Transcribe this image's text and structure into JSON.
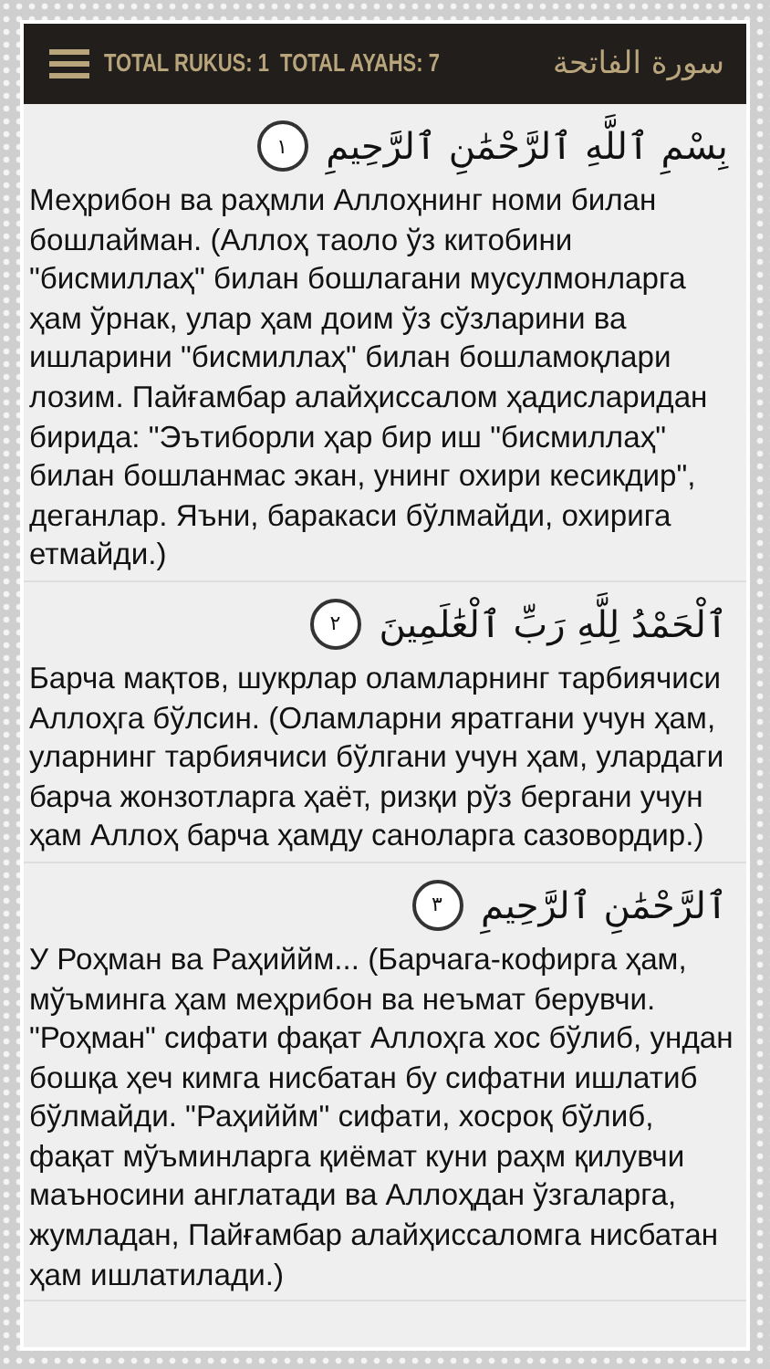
{
  "header": {
    "stats": "TOTAL RUKUS: 1  TOTAL AYAHS: 7",
    "surah_title": "سورة الفاتحة"
  },
  "ayahs": [
    {
      "arabic": "بِسْمِ ٱللَّهِ ٱلرَّحْمَٰنِ ٱلرَّحِيمِ",
      "number": "١",
      "translation": "Меҳрибон ва раҳмли Аллоҳнинг номи билан бошлайман. (Аллоҳ таоло ўз китобини \"бисмиллаҳ\" билан бошлагани мусулмонларга ҳам ўрнак, улар ҳам доим ўз сўзларини ва ишларини \"бисмиллаҳ\" билан бошламоқлари лозим. Пайғамбар алайҳиссалом ҳадисларидан бирида: \"Эътиборли ҳар бир иш \"бисмиллаҳ\" билан бошланмас экан, унинг охири кесикдир\", деганлар. Яъни, баракаси бўлмайди, охирига етмайди.)"
    },
    {
      "arabic": "ٱلْحَمْدُ لِلَّهِ رَبِّ ٱلْعَٰلَمِينَ",
      "number": "٢",
      "translation": "Барча мақтов, шукрлар оламларнинг тарбиячиси Аллоҳга бўлсин. (Оламларни яратгани учун ҳам, уларнинг тарбиячиси бўлгани учун ҳам, улардаги барча жонзотларга ҳаёт, ризқи рўз бергани учун ҳам Аллоҳ барча ҳамду саноларга сазовордир.)"
    },
    {
      "arabic": "ٱلرَّحْمَٰنِ ٱلرَّحِيمِ",
      "number": "٣",
      "translation": "У Роҳман ва Раҳиййм... (Барчага-кофирга ҳам, мўъминга ҳам меҳрибон ва неъмат берувчи. \"Роҳман\" сифати фақат Аллоҳга хос бўлиб, ундан бошқа ҳеч кимга нисбатан бу сифатни ишлатиб бўлмайди. \"Раҳиййм\" сифати, хосроқ бўлиб, фақат мўъминларга қиёмат куни раҳм қилувчи маъносини англатади ва Аллоҳдан ўзгаларга, жумладан, Пайғамбар алайҳиссаломга нисбатан ҳам ишлатилади.)"
    }
  ]
}
